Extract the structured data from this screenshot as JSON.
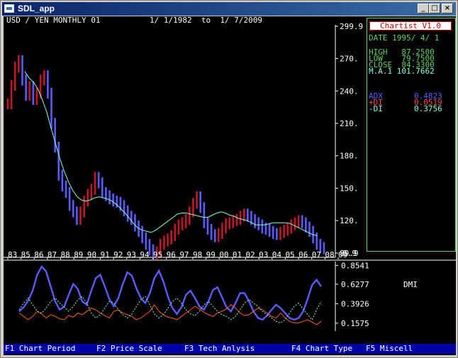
{
  "window": {
    "title": "SDL_app"
  },
  "chart_header": {
    "left": "USD / YEN MONTHLY 01",
    "date_range": "1/ 1/1982  to  1/ 7/2009"
  },
  "info_panel": {
    "app_name": "Chartist V1.0",
    "date": "DATE 1995/ 4/ 1",
    "high": "HIGH   87.2500",
    "low": "LOW    79.7500",
    "close": "CLOSE  84.3300",
    "ma1": "M.A.1 101.7662",
    "adx_label": "ADX",
    "adx_value": "0.4823",
    "pdi_label": "+DI",
    "pdi_value": "0.0519",
    "mdi_label": "-DI",
    "mdi_value": "0.3756"
  },
  "indicator": {
    "label": "DMI"
  },
  "menu": [
    {
      "label": "F1 Chart Period"
    },
    {
      "label": "F2 Price Scale"
    },
    {
      "label": "F3 Tech Anlysis"
    },
    {
      "label": "F4 Chart Type"
    },
    {
      "label": "F5 Miscell"
    }
  ],
  "colors": {
    "price_up": "#c0182a",
    "price_down": "#5a5aff",
    "ma": "#7fffe0",
    "adx": "#5a5aff",
    "pdi": "#ff5a1e",
    "mdi": "#7fffe0",
    "panel_border": "#5ed55e"
  },
  "chart_data": [
    {
      "type": "line",
      "title": "USD / YEN MONTHLY 01",
      "ylim": [
        89.9,
        299.9
      ],
      "y_ticks": [
        "299.9",
        "270.",
        "240.",
        "210.",
        "180.",
        "150.",
        "120.",
        "89.9"
      ],
      "y_tick_values": [
        299.9,
        270,
        240,
        210,
        180,
        150,
        120,
        89.9
      ],
      "bottom_tick": "9.9",
      "x_ticks": [
        "83",
        "85",
        "86",
        "87",
        "88",
        "89",
        "90",
        "91",
        "92",
        "93",
        "94",
        "95",
        "96",
        "97",
        "98",
        "99",
        "00",
        "01",
        "02",
        "03",
        "04",
        "05",
        "06",
        "07",
        "08",
        "09"
      ],
      "series": [
        {
          "values": [
            228,
            245,
            262,
            268,
            250,
            236,
            244,
            232,
            238,
            250,
            254,
            238,
            210,
            188,
            162,
            152,
            146,
            134,
            128,
            121,
            128,
            138,
            144,
            149,
            160,
            155,
            146,
            143,
            140,
            138,
            137,
            134,
            129,
            124,
            121,
            115,
            110,
            104,
            98,
            93,
            89,
            91,
            98,
            101,
            103,
            106,
            112,
            116,
            118,
            121,
            128,
            136,
            142,
            132,
            118,
            112,
            107,
            105,
            108,
            113,
            117,
            118,
            120,
            121,
            124,
            126,
            124,
            121,
            118,
            116,
            113,
            112,
            110,
            108,
            107,
            109,
            111,
            113,
            116,
            118,
            120,
            118,
            114,
            110,
            104,
            98,
            95,
            94
          ]
        },
        {
          "values": [
            258,
            252,
            248,
            242,
            232,
            221,
            206,
            192,
            178,
            166,
            156,
            148,
            142,
            139,
            138,
            139,
            141,
            142,
            141,
            140,
            138,
            135,
            131,
            127,
            122,
            117,
            113,
            111,
            110,
            109,
            111,
            114,
            117,
            120,
            123,
            126,
            127,
            127,
            126,
            125,
            124,
            123,
            123,
            125,
            127,
            128,
            127,
            125,
            124,
            122,
            121,
            120,
            118,
            116,
            116,
            116,
            117,
            118,
            118,
            118,
            118,
            117,
            115,
            113,
            111,
            109,
            107,
            106
          ]
        }
      ]
    },
    {
      "type": "line",
      "title": "DMI",
      "ylim": [
        0.08,
        0.9
      ],
      "y_ticks": [
        "0.8541",
        "0.6277",
        "0.3926",
        "0.1575"
      ],
      "y_tick_values": [
        0.8541,
        0.6277,
        0.3926,
        0.1575
      ],
      "series": [
        {
          "values": [
            0.3,
            0.35,
            0.43,
            0.55,
            0.74,
            0.84,
            0.78,
            0.6,
            0.42,
            0.32,
            0.36,
            0.5,
            0.63,
            0.57,
            0.42,
            0.38,
            0.55,
            0.7,
            0.74,
            0.6,
            0.45,
            0.36,
            0.46,
            0.63,
            0.77,
            0.73,
            0.58,
            0.46,
            0.4,
            0.52,
            0.7,
            0.79,
            0.66,
            0.48,
            0.34,
            0.27,
            0.35,
            0.5,
            0.55,
            0.46,
            0.36,
            0.32,
            0.42,
            0.56,
            0.59,
            0.47,
            0.35,
            0.3,
            0.4,
            0.52,
            0.52,
            0.42,
            0.3,
            0.22,
            0.2,
            0.25,
            0.32,
            0.38,
            0.34,
            0.28,
            0.22,
            0.2,
            0.22,
            0.3,
            0.45,
            0.62,
            0.68,
            0.6
          ]
        },
        {
          "values": [
            0.28,
            0.24,
            0.2,
            0.24,
            0.3,
            0.27,
            0.22,
            0.26,
            0.24,
            0.21,
            0.2,
            0.25,
            0.23,
            0.28,
            0.26,
            0.3,
            0.34,
            0.32,
            0.28,
            0.25,
            0.22,
            0.3,
            0.32,
            0.28,
            0.26,
            0.24,
            0.2,
            0.22,
            0.26,
            0.3,
            0.38,
            0.3,
            0.26,
            0.23,
            0.22,
            0.2,
            0.24,
            0.28,
            0.32,
            0.36,
            0.33,
            0.29,
            0.26,
            0.24,
            0.28,
            0.3,
            0.33,
            0.38,
            0.34,
            0.28,
            0.25,
            0.26,
            0.3,
            0.34,
            0.32,
            0.28,
            0.24,
            0.22,
            0.28,
            0.22,
            0.18,
            0.16,
            0.16,
            0.18,
            0.2,
            0.17,
            0.14,
            0.18
          ]
        },
        {
          "values": [
            0.32,
            0.4,
            0.46,
            0.38,
            0.3,
            0.28,
            0.34,
            0.42,
            0.46,
            0.4,
            0.35,
            0.3,
            0.36,
            0.44,
            0.48,
            0.4,
            0.28,
            0.22,
            0.26,
            0.34,
            0.42,
            0.4,
            0.32,
            0.26,
            0.22,
            0.27,
            0.36,
            0.44,
            0.48,
            0.38,
            0.27,
            0.22,
            0.26,
            0.34,
            0.42,
            0.46,
            0.4,
            0.32,
            0.27,
            0.25,
            0.3,
            0.38,
            0.42,
            0.36,
            0.3,
            0.26,
            0.24,
            0.2,
            0.24,
            0.32,
            0.4,
            0.44,
            0.4,
            0.36,
            0.3,
            0.26,
            0.22,
            0.18,
            0.16,
            0.2,
            0.28,
            0.36,
            0.4,
            0.33,
            0.26,
            0.2,
            0.32,
            0.42
          ]
        }
      ]
    }
  ]
}
